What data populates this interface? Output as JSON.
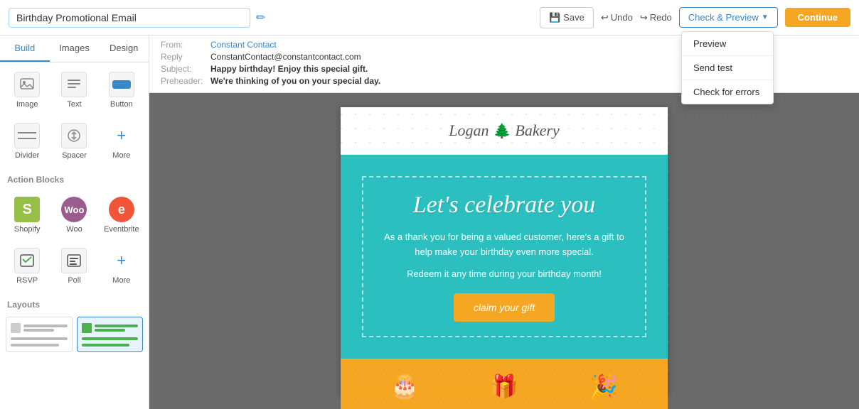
{
  "topbar": {
    "title": "Birthday Promotional Email",
    "save_label": "Save",
    "undo_label": "Undo",
    "redo_label": "Redo",
    "check_preview_label": "Check & Preview",
    "continue_label": "Continue"
  },
  "dropdown": {
    "items": [
      "Preview",
      "Send test",
      "Check for errors"
    ]
  },
  "sidebar": {
    "tabs": [
      "Build",
      "Images",
      "Design"
    ],
    "active_tab": "Build",
    "blocks": [
      {
        "label": "Image",
        "icon": "🖼"
      },
      {
        "label": "Text",
        "icon": "T"
      },
      {
        "label": "Button",
        "icon": "⬛"
      },
      {
        "label": "Divider",
        "icon": "—"
      },
      {
        "label": "Spacer",
        "icon": "↕"
      },
      {
        "label": "More",
        "icon": "+"
      }
    ],
    "action_blocks_label": "Action Blocks",
    "action_blocks": [
      {
        "label": "Shopify",
        "type": "shopify"
      },
      {
        "label": "Woo",
        "type": "woo"
      },
      {
        "label": "Eventbrite",
        "type": "eventbrite"
      },
      {
        "label": "RSVP",
        "type": "rsvp"
      },
      {
        "label": "Poll",
        "type": "poll"
      },
      {
        "label": "More",
        "type": "more"
      }
    ],
    "layouts_label": "Layouts"
  },
  "email_info": {
    "from_label": "From:",
    "from_value": "Constant Contact",
    "reply_label": "Reply",
    "reply_value": "ConstantContact@constantcontact.com",
    "subject_label": "Subject:",
    "subject_value": "Happy birthday! Enjoy this special gift.",
    "preheader_label": "Preheader:",
    "preheader_value": "We're thinking of you on your special day."
  },
  "email_content": {
    "logo_text": "Logan",
    "logo_suffix": "Bakery",
    "heading": "Let's celebrate you",
    "subtext": "As a thank you for being a valued customer, here's a gift to help make your birthday even more special.",
    "redeem_text": "Redeem it any time during your birthday month!",
    "claim_button": "claim your gift"
  }
}
